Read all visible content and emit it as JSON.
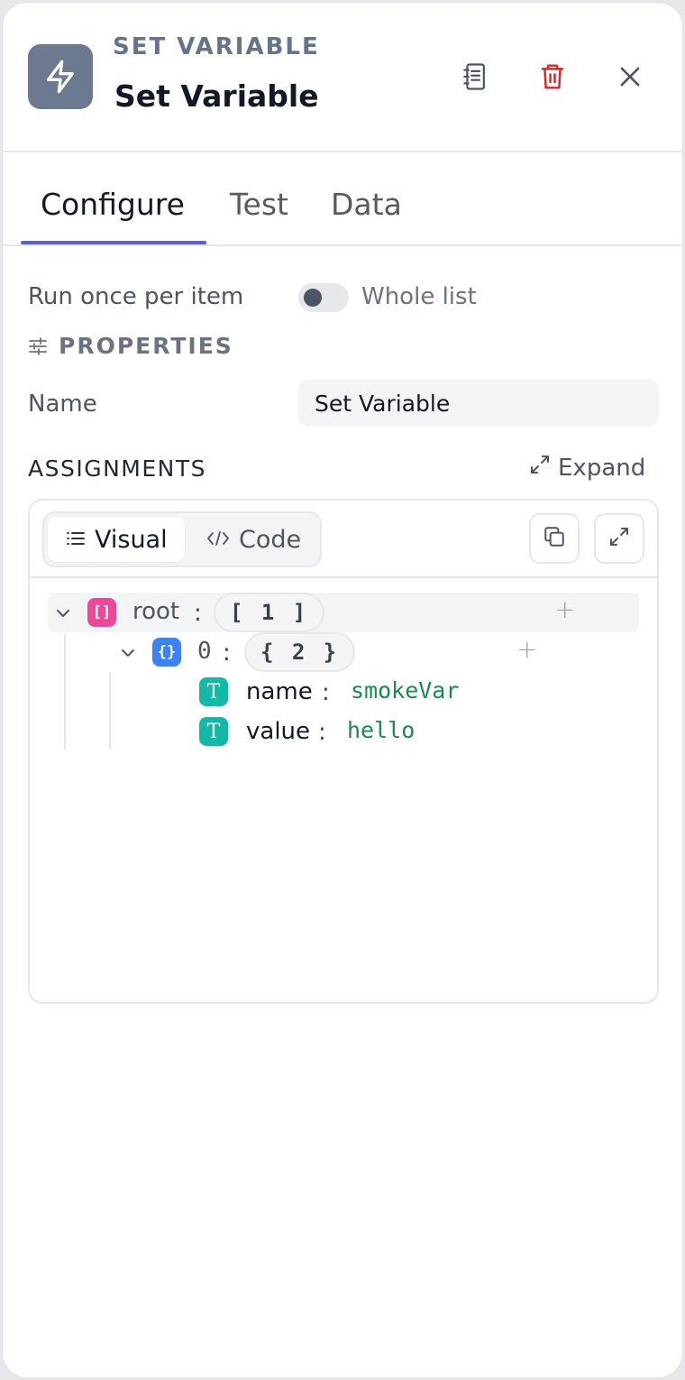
{
  "header": {
    "node_type": "SET VARIABLE",
    "title": "Set Variable",
    "icons": {
      "node": "lightning-icon",
      "notes": "notebook-icon",
      "delete": "trash-icon",
      "close": "close-icon"
    }
  },
  "tabs": [
    {
      "label": "Configure",
      "active": true
    },
    {
      "label": "Test",
      "active": false
    },
    {
      "label": "Data",
      "active": false
    }
  ],
  "run_once": {
    "label": "Run once per item",
    "toggle_label": "Whole list",
    "enabled": false
  },
  "properties": {
    "section_label": "PROPERTIES",
    "name_label": "Name",
    "name_value": "Set Variable"
  },
  "assignments": {
    "section_label": "ASSIGNMENTS",
    "expand_label": "Expand",
    "modes": {
      "visual": "Visual",
      "code": "Code",
      "active": "visual"
    },
    "tree": {
      "root_key": "root",
      "root_count": "[ 1 ]",
      "item_key": "0",
      "item_count": "{ 2 }",
      "fields": [
        {
          "key": "name",
          "value": "smokeVar",
          "type_symbol": "T"
        },
        {
          "key": "value",
          "value": "hello",
          "type_symbol": "T"
        }
      ],
      "array_symbol": "[]",
      "object_symbol": "{}"
    }
  },
  "colors": {
    "accent": "#5b5fd6",
    "delete": "#dc2626",
    "string_value": "#1a8a4e",
    "array_badge": "#ec4899",
    "object_badge": "#3b82f6",
    "string_badge": "#14b8a6"
  }
}
